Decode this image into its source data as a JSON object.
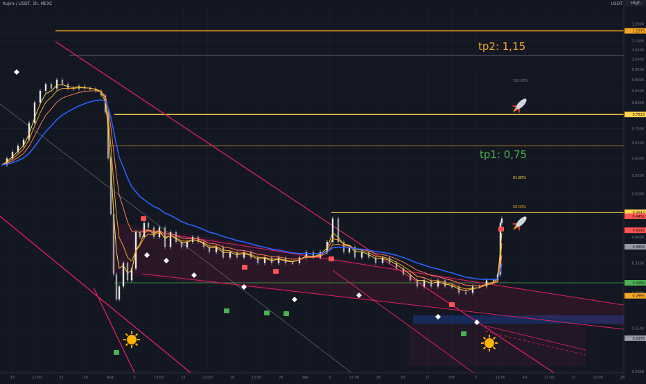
{
  "header": {
    "symbol": "Kujira / USDT, 1h, MEXC",
    "currency": "USDT",
    "flag_text": "High"
  },
  "colors": {
    "background": "#131722",
    "candle_up": "#e6e6e6",
    "candle_down": "#a0a0a0",
    "ema_fast": "#f5a623",
    "ema_mid": "#ff7b52",
    "ema_slow": "#ffd34d",
    "ema_long": "#2962ff",
    "channel_red": "#e91e63",
    "fib_yellow": "#ffd34d",
    "tp2_line": "#f5a623",
    "tp1_text": "#4caf50",
    "label_red": "#ff5252",
    "label_green": "#4caf50"
  },
  "annotations": {
    "tp2": "tp2: 1,15",
    "tp1": "tp1: 0,75",
    "fib_100": "100.00%",
    "fib_618": "61.80%",
    "fib_50": "50.00%",
    "low_label": "Low",
    "icons": [
      "rocket-icon",
      "rocket-icon",
      "sun-icon",
      "sun-icon"
    ]
  },
  "chart_data": {
    "type": "candlestick",
    "title": "Kujira / USDT, 1h, MEXC",
    "ylabel": "USDT",
    "y_scale": "log",
    "ylim": [
      0.2,
      1.3
    ],
    "y_ticks": [
      {
        "value": 1.2,
        "label": "1.2000"
      },
      {
        "value": 1.15,
        "label": "1.1500"
      },
      {
        "value": 1.1,
        "label": "1.1000"
      },
      {
        "value": 1.05,
        "label": "1.0500"
      },
      {
        "value": 1.0,
        "label": "1.0000"
      },
      {
        "value": 0.95,
        "label": "0.9500"
      },
      {
        "value": 0.9,
        "label": "0.9000"
      },
      {
        "value": 0.85,
        "label": "0.8500"
      },
      {
        "value": 0.8,
        "label": "0.8000"
      },
      {
        "value": 0.75,
        "label": "0.7500"
      },
      {
        "value": 0.7,
        "label": "0.7000"
      },
      {
        "value": 0.65,
        "label": "0.6500"
      },
      {
        "value": 0.6,
        "label": "0.6000"
      },
      {
        "value": 0.55,
        "label": "0.5500"
      },
      {
        "value": 0.5,
        "label": "0.5000"
      },
      {
        "value": 0.45,
        "label": "0.4500"
      },
      {
        "value": 0.4,
        "label": "0.4000"
      },
      {
        "value": 0.35,
        "label": "0.3500"
      },
      {
        "value": 0.3,
        "label": "0.3000"
      },
      {
        "value": 0.25,
        "label": "0.2500"
      },
      {
        "value": 0.2,
        "label": "0.2000"
      }
    ],
    "x_ticks": [
      "15",
      "12:00",
      "22",
      "26",
      "Aug",
      "5",
      "12:00",
      "12",
      "12:00",
      "19",
      "12:00",
      "26",
      "Sep",
      "9",
      "12:00",
      "16",
      "23",
      "27",
      "Oct",
      "7",
      "12:00",
      "14",
      "12:00",
      "21",
      "12:00",
      "28"
    ],
    "price_labels": [
      {
        "value": 1.1575,
        "label": "1.1575",
        "color": "#f5a623"
      },
      {
        "value": 0.7523,
        "label": "0.7523",
        "color": "#ffd34d"
      },
      {
        "value": 0.4543,
        "label": "0.4543",
        "color": "#ffd34d"
      },
      {
        "value": 0.4451,
        "label": "0.4451",
        "color": "#ff5252"
      },
      {
        "value": 0.4142,
        "label": "0.4142",
        "color": "#ff5252"
      },
      {
        "value": 0.3805,
        "label": "0.3805",
        "color": "#9598a1"
      },
      {
        "value": 0.3159,
        "label": "0.3159",
        "color": "#4caf50"
      },
      {
        "value": 0.2955,
        "label": "0.2955",
        "color": "#f5a623"
      },
      {
        "value": 0.2375,
        "label": "0.2375",
        "color": "#9598a1"
      }
    ],
    "horizontal_levels": [
      {
        "name": "tp2",
        "value": 1.1575,
        "color": "#f5a623"
      },
      {
        "name": "fib 100%",
        "value": 1.02,
        "color": "#787b86"
      },
      {
        "name": "fib 61.8%",
        "value": 0.7523,
        "color": "#ffd34d"
      },
      {
        "name": "fib 50%",
        "value": 0.64,
        "color": "#f5a623"
      },
      {
        "name": "resistance",
        "value": 0.4543,
        "color": "#ffd34d"
      },
      {
        "name": "support",
        "value": 0.3159,
        "color": "#4caf50"
      }
    ],
    "price_path": [
      [
        0,
        0.58
      ],
      [
        8,
        0.6
      ],
      [
        16,
        0.62
      ],
      [
        24,
        0.64
      ],
      [
        32,
        0.66
      ],
      [
        40,
        0.72
      ],
      [
        48,
        0.8
      ],
      [
        56,
        0.85
      ],
      [
        64,
        0.88
      ],
      [
        72,
        0.86
      ],
      [
        80,
        0.9
      ],
      [
        88,
        0.88
      ],
      [
        96,
        0.86
      ],
      [
        104,
        0.86
      ],
      [
        112,
        0.87
      ],
      [
        120,
        0.86
      ],
      [
        128,
        0.86
      ],
      [
        136,
        0.85
      ],
      [
        144,
        0.83
      ],
      [
        150,
        0.76
      ],
      [
        154,
        0.6
      ],
      [
        158,
        0.45
      ],
      [
        162,
        0.33
      ],
      [
        166,
        0.29
      ],
      [
        170,
        0.31
      ],
      [
        176,
        0.35
      ],
      [
        182,
        0.32
      ],
      [
        188,
        0.34
      ],
      [
        194,
        0.41
      ],
      [
        200,
        0.4
      ],
      [
        206,
        0.43
      ],
      [
        212,
        0.42
      ],
      [
        220,
        0.4
      ],
      [
        228,
        0.42
      ],
      [
        236,
        0.38
      ],
      [
        244,
        0.41
      ],
      [
        252,
        0.39
      ],
      [
        260,
        0.38
      ],
      [
        268,
        0.39
      ],
      [
        276,
        0.4
      ],
      [
        284,
        0.39
      ],
      [
        292,
        0.38
      ],
      [
        300,
        0.37
      ],
      [
        310,
        0.38
      ],
      [
        320,
        0.36
      ],
      [
        330,
        0.37
      ],
      [
        340,
        0.36
      ],
      [
        350,
        0.37
      ],
      [
        360,
        0.36
      ],
      [
        370,
        0.35
      ],
      [
        380,
        0.36
      ],
      [
        390,
        0.35
      ],
      [
        400,
        0.36
      ],
      [
        410,
        0.35
      ],
      [
        420,
        0.35
      ],
      [
        430,
        0.36
      ],
      [
        440,
        0.37
      ],
      [
        450,
        0.36
      ],
      [
        460,
        0.37
      ],
      [
        470,
        0.39
      ],
      [
        478,
        0.44
      ],
      [
        486,
        0.39
      ],
      [
        494,
        0.37
      ],
      [
        502,
        0.38
      ],
      [
        510,
        0.36
      ],
      [
        520,
        0.37
      ],
      [
        530,
        0.36
      ],
      [
        540,
        0.35
      ],
      [
        550,
        0.36
      ],
      [
        560,
        0.35
      ],
      [
        570,
        0.34
      ],
      [
        580,
        0.33
      ],
      [
        590,
        0.32
      ],
      [
        600,
        0.31
      ],
      [
        610,
        0.32
      ],
      [
        620,
        0.31
      ],
      [
        630,
        0.32
      ],
      [
        640,
        0.31
      ],
      [
        650,
        0.31
      ],
      [
        660,
        0.3
      ],
      [
        670,
        0.3
      ],
      [
        680,
        0.31
      ],
      [
        690,
        0.31
      ],
      [
        700,
        0.32
      ],
      [
        710,
        0.32
      ],
      [
        716,
        0.33
      ],
      [
        720,
        0.43
      ],
      [
        722,
        0.44
      ]
    ],
    "legend": null,
    "grid": true
  }
}
